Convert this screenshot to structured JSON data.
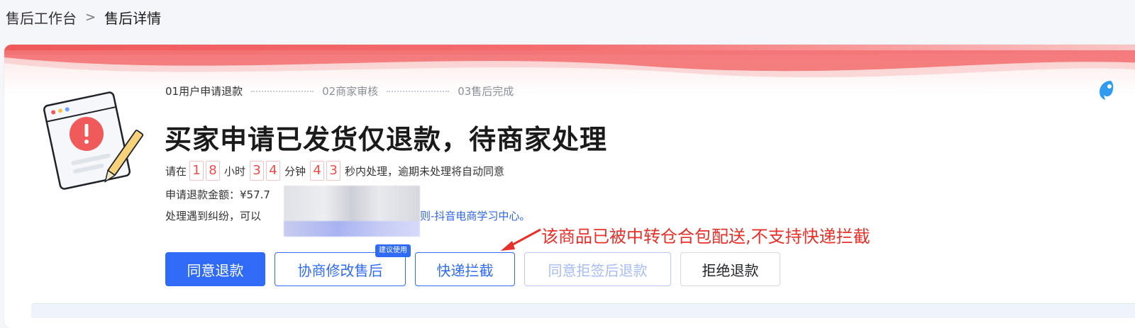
{
  "breadcrumb": {
    "root": "售后工作台",
    "separator": ">",
    "current": "售后详情"
  },
  "steps": [
    {
      "label": "01用户申请退款"
    },
    {
      "label": "02商家审核"
    },
    {
      "label": "03售后完成"
    }
  ],
  "status": {
    "title": "买家申请已发货仅退款，待商家处理"
  },
  "countdown": {
    "prefix": "请在",
    "hours": [
      "1",
      "8"
    ],
    "hours_unit": "小时",
    "minutes": [
      "3",
      "4"
    ],
    "minutes_unit": "分钟",
    "seconds": [
      "4",
      "3"
    ],
    "suffix": "秒内处理，逾期未处理将自动同意"
  },
  "refund": {
    "amount_text": "申请退款金额：¥57.7"
  },
  "dispute": {
    "text": "处理遇到纠纷，可以",
    "link_tail": "则-抖音电商学习中心。"
  },
  "annotation": {
    "text": "该商品已被中转仓合包配送,不支持快递拦截",
    "color": "#e8302a"
  },
  "actions": {
    "agree": "同意退款",
    "negotiate": "协商修改售后",
    "negotiate_tag": "建议使用",
    "intercept": "快递拦截",
    "agree_after_reject": "同意拒签后退款",
    "reject": "拒绝退款"
  },
  "colors": {
    "primary": "#2f6bf6",
    "danger": "#f04b4b",
    "banner": "#f0595b"
  },
  "icons": {
    "illustration": "alert-document-illustration",
    "side": "assistant-icon"
  }
}
